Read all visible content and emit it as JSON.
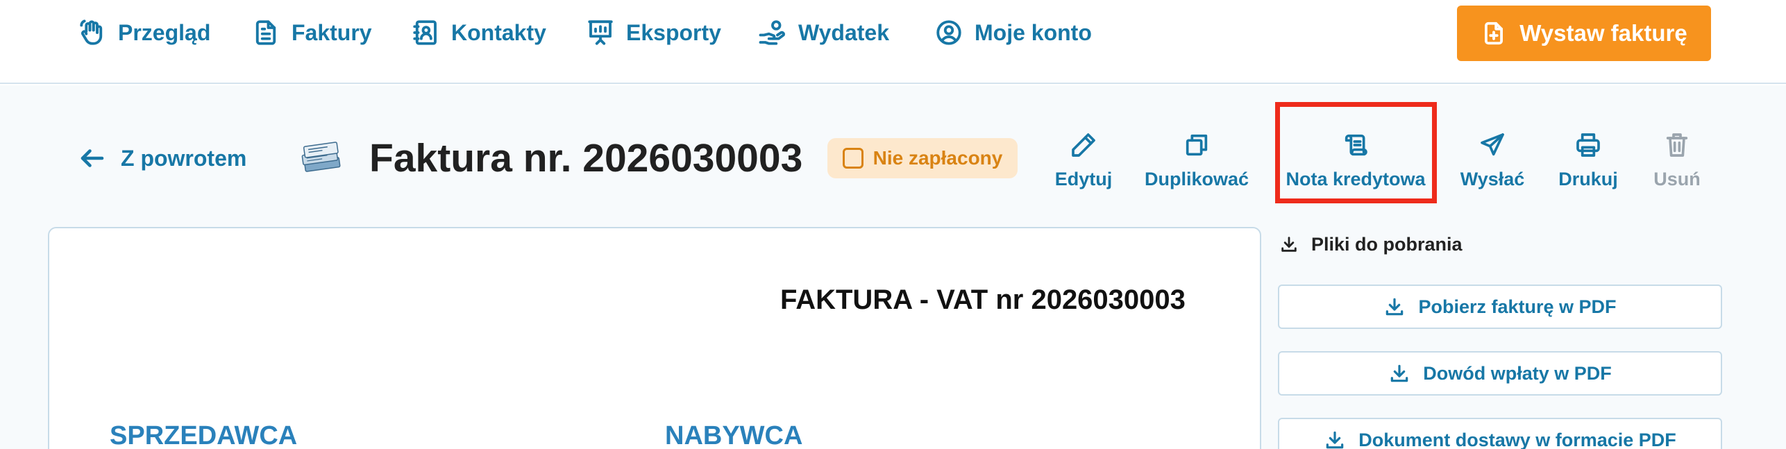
{
  "nav": {
    "items": [
      {
        "label": "Przegląd",
        "icon": "hand-wave-icon"
      },
      {
        "label": "Faktury",
        "icon": "document-icon"
      },
      {
        "label": "Kontakty",
        "icon": "contact-book-icon"
      },
      {
        "label": "Eksporty",
        "icon": "presentation-chart-icon"
      },
      {
        "label": "Wydatek",
        "icon": "hand-coins-icon"
      },
      {
        "label": "Moje konto",
        "icon": "user-circle-icon"
      }
    ],
    "cta_label": "Wystaw fakturę",
    "cta_icon": "file-plus-icon"
  },
  "header": {
    "back_label": "Z powrotem",
    "title": "Faktura nr. 2026030003",
    "status": "Nie zapłacony"
  },
  "actions": [
    {
      "label": "Edytuj",
      "icon": "pencil-icon"
    },
    {
      "label": "Duplikować",
      "icon": "copy-icon"
    },
    {
      "label": "Nota kredytowa",
      "icon": "scroll-icon"
    },
    {
      "label": "Wysłać",
      "icon": "send-icon"
    },
    {
      "label": "Drukuj",
      "icon": "printer-icon"
    },
    {
      "label": "Usuń",
      "icon": "trash-icon",
      "disabled": true
    }
  ],
  "document": {
    "heading": "FAKTURA - VAT nr 2026030003",
    "seller_label": "SPRZEDAWCA",
    "buyer_label": "NABYWCA"
  },
  "downloads": {
    "heading": "Pliki do pobrania",
    "buttons": [
      "Pobierz fakturę w PDF",
      "Dowód wpłaty w PDF",
      "Dokument dostawy w formacie PDF"
    ]
  },
  "colors": {
    "accent": "#1777a6",
    "cta": "#f7931e",
    "status_bg": "#fde8cd",
    "status_text": "#d98313",
    "highlight": "#ee2b1b"
  }
}
